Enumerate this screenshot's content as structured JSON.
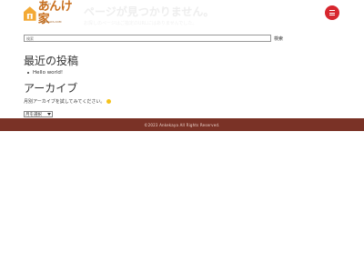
{
  "header": {
    "logo_text": "あんけ家",
    "logo_tagline": "Anke-ya",
    "logo_sub": "ANKEKAYA.COM",
    "ghost_title": "ページが見つかりません。",
    "ghost_subtitle": "お探しのページはご指定のURLにはありませんでした。",
    "menu_icon": "hamburger-icon",
    "menu_color": "#d7262e"
  },
  "search": {
    "placeholder": "検索",
    "button_label": "検索"
  },
  "recent": {
    "heading": "最近の投稿",
    "items": [
      "Hello world!"
    ]
  },
  "archive": {
    "heading": "アーカイブ",
    "description": "月別アーカイブを試してみてください。",
    "select_value": "月を選択"
  },
  "footer": {
    "text": "©2023 Ankekaya All Rights Reserved.",
    "bg_color": "#7a3226"
  }
}
